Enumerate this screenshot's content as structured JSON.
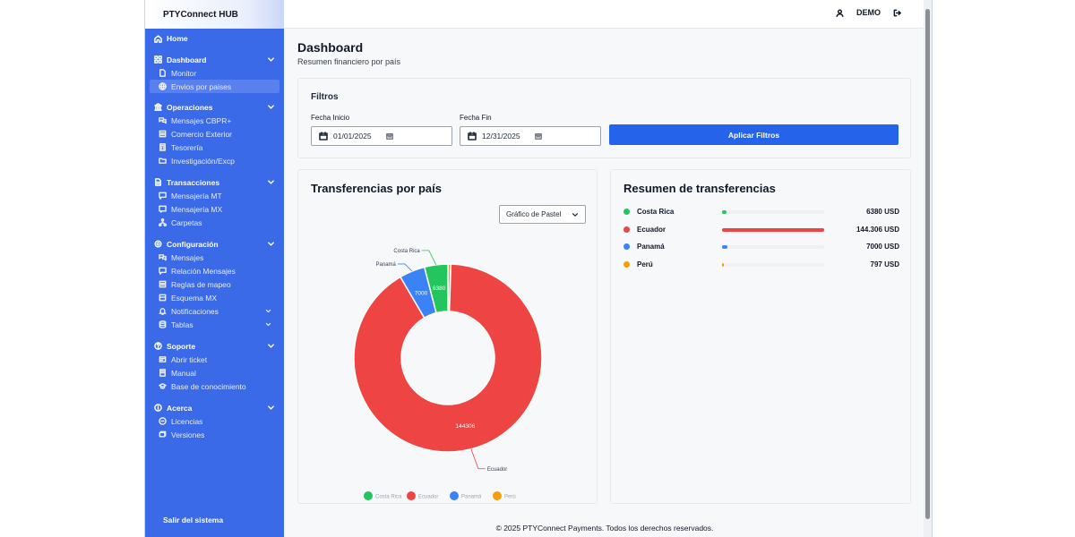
{
  "app": {
    "title": "PTYConnect HUB",
    "user": "DEMO"
  },
  "sidebar": {
    "home": "Home",
    "groups": [
      {
        "label": "Dashboard",
        "items": [
          {
            "label": "Monitor"
          },
          {
            "label": "Envios por paises"
          }
        ]
      },
      {
        "label": "Operaciones",
        "items": [
          {
            "label": "Mensajes CBPR+"
          },
          {
            "label": "Comercio Exterior"
          },
          {
            "label": "Tesorería"
          },
          {
            "label": "Investigación/Excp"
          }
        ]
      },
      {
        "label": "Transacciones",
        "items": [
          {
            "label": "Mensajería MT"
          },
          {
            "label": "Mensajería MX"
          },
          {
            "label": "Carpetas"
          }
        ]
      },
      {
        "label": "Configuración",
        "items": [
          {
            "label": "Mensajes"
          },
          {
            "label": "Relación Mensajes"
          },
          {
            "label": "Reglas de mapeo"
          },
          {
            "label": "Esquema MX"
          },
          {
            "label": "Notificaciones"
          },
          {
            "label": "Tablas"
          }
        ]
      },
      {
        "label": "Soporte",
        "items": [
          {
            "label": "Abrir ticket"
          },
          {
            "label": "Manual"
          },
          {
            "label": "Base de conocimiento"
          }
        ]
      },
      {
        "label": "Acerca",
        "items": [
          {
            "label": "Licencias"
          },
          {
            "label": "Versiones"
          }
        ]
      }
    ],
    "logout": "Salir del sistema"
  },
  "page": {
    "title": "Dashboard",
    "subtitle": "Resumen financiero por país"
  },
  "filters": {
    "title": "Filtros",
    "start_label": "Fecha Inicio",
    "start_value": "01/01/2025",
    "end_label": "Fecha Fin",
    "end_value": "12/31/2025",
    "apply_label": "Aplicar Filtros"
  },
  "chart_card": {
    "title": "Transferencias por país",
    "chart_type_select": "Gráfico de Pastel"
  },
  "chart_data": {
    "type": "pie",
    "categories": [
      "Costa Rica",
      "Ecuador",
      "Panamá",
      "Perú"
    ],
    "values": [
      6380,
      144306,
      7000,
      797
    ],
    "data_labels": [
      "6380",
      "144306",
      "7000",
      ""
    ],
    "colors": [
      "#22c55e",
      "#ef4444",
      "#3b82f6",
      "#f59e0b"
    ],
    "donut": true,
    "legend": "bottom"
  },
  "summary": {
    "title": "Resumen de transferencias",
    "rows": [
      {
        "name": "Costa Rica",
        "amount": "6380 USD",
        "fraction": 0.044,
        "color": "#22c55e"
      },
      {
        "name": "Ecuador",
        "amount": "144.306 USD",
        "fraction": 1.0,
        "color": "#ef4444"
      },
      {
        "name": "Panamá",
        "amount": "7000 USD",
        "fraction": 0.049,
        "color": "#3b82f6"
      },
      {
        "name": "Perú",
        "amount": "797 USD",
        "fraction": 0.006,
        "color": "#f59e0b"
      }
    ]
  },
  "footer": "© 2025 PTYConnect Payments. Todos los derechos reservados."
}
